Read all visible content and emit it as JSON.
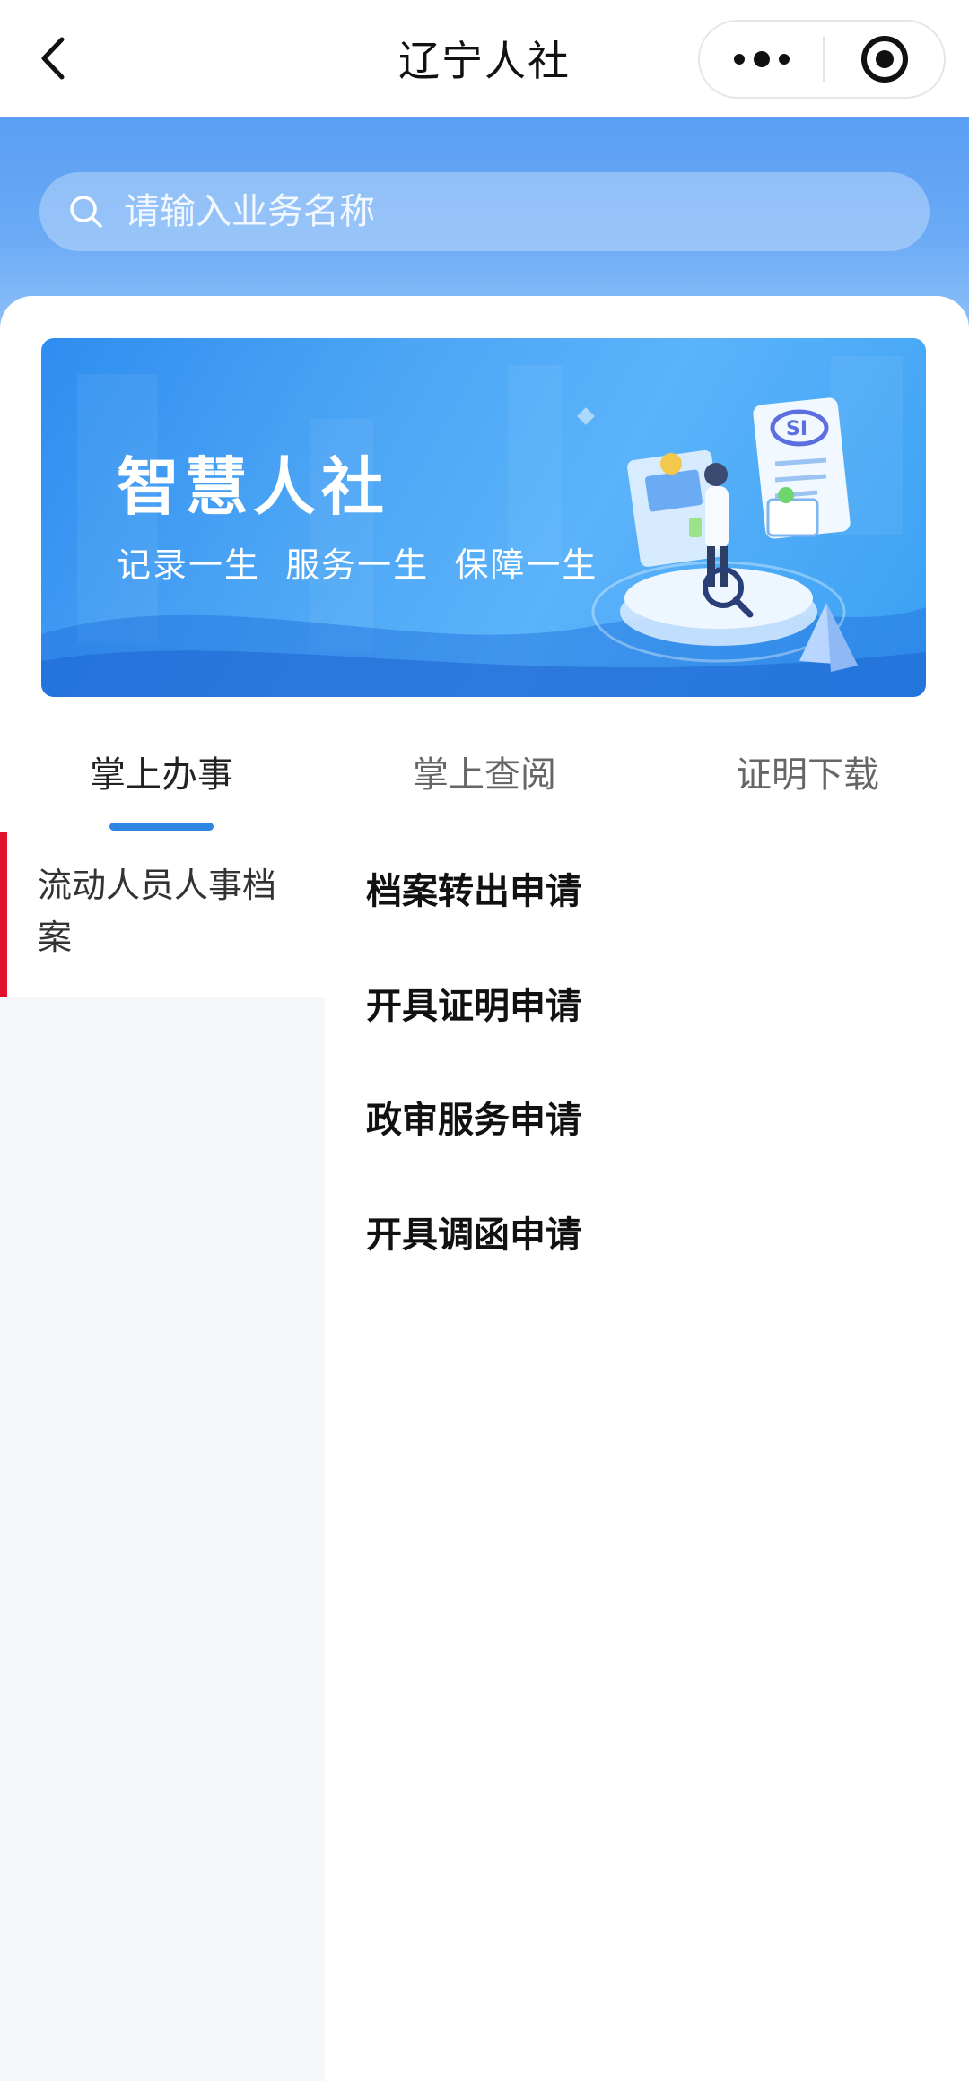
{
  "navbar": {
    "title": "辽宁人社",
    "back_icon": "chevron-left-icon",
    "more_icon": "more-dots-icon",
    "target_icon": "target-icon"
  },
  "search": {
    "placeholder": "请输入业务名称",
    "icon": "search-icon"
  },
  "banner": {
    "title": "智慧人社",
    "subtitle": "记录一生  服务一生  保障一生"
  },
  "tabs": [
    {
      "label": "掌上办事",
      "active": true
    },
    {
      "label": "掌上查阅",
      "active": false
    },
    {
      "label": "证明下载",
      "active": false
    }
  ],
  "categories": [
    {
      "label": "流动人员人事档案",
      "selected": true
    }
  ],
  "services": [
    {
      "label": "档案转出申请"
    },
    {
      "label": "开具证明申请"
    },
    {
      "label": "政审服务申请"
    },
    {
      "label": "开具调函申请"
    }
  ],
  "colors": {
    "accent": "#2d86e0",
    "selected_marker": "#e1122b",
    "header_blue": "#5a9ff4"
  }
}
